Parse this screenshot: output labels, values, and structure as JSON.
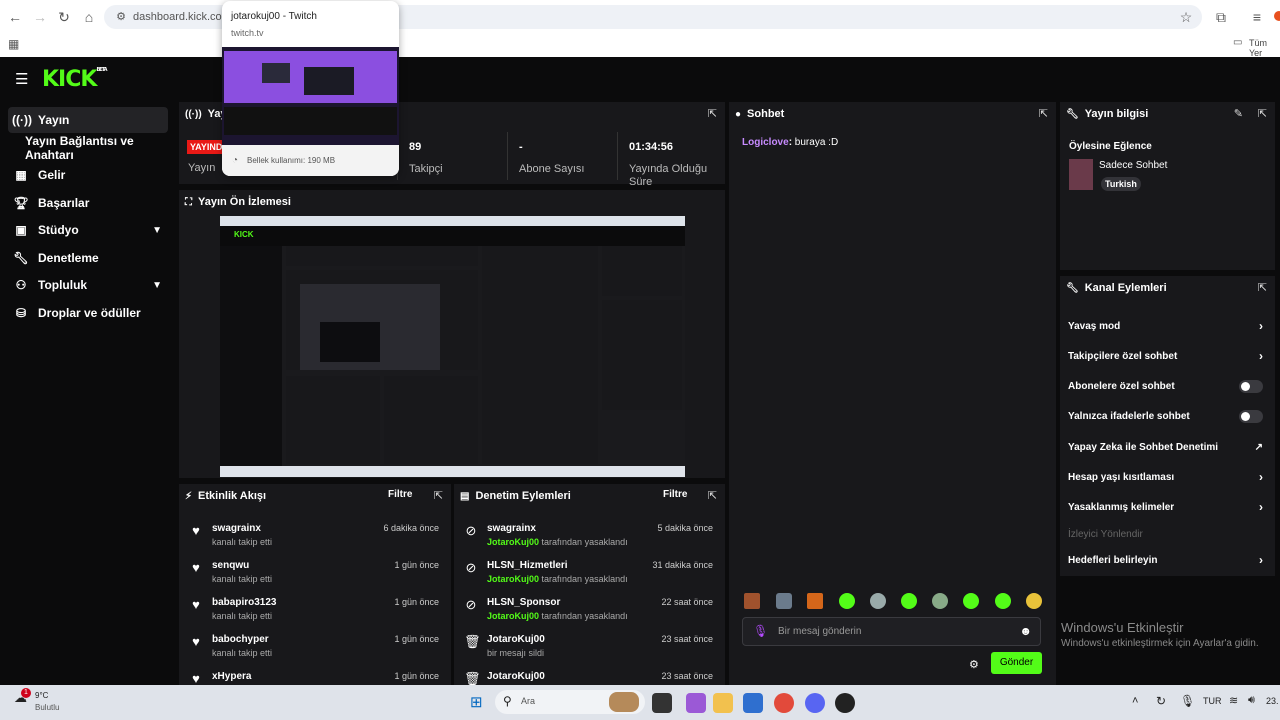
{
  "browser": {
    "url": "dashboard.kick.com/",
    "right_bookmark": "Tüm Yer",
    "tab_preview": {
      "title": "jotarokuj00 - Twitch",
      "domain": "twitch.tv",
      "memory": "Bellek kullanımı: 190 MB"
    }
  },
  "app": {
    "logo": "KICK",
    "logo_badge": "BETA"
  },
  "sidebar": {
    "items": [
      {
        "label": "Yayın",
        "icon": "broadcast-icon",
        "active": true
      },
      {
        "label": "Yayın Bağlantısı ve Anahtarı",
        "icon": "",
        "sub": true
      },
      {
        "label": "Gelir",
        "icon": "chart-icon"
      },
      {
        "label": "Başarılar",
        "icon": "trophy-icon"
      },
      {
        "label": "Stüdyo",
        "icon": "studio-icon",
        "chevron": true
      },
      {
        "label": "Denetleme",
        "icon": "wrench-icon"
      },
      {
        "label": "Topluluk",
        "icon": "community-icon",
        "chevron": true
      },
      {
        "label": "Droplar ve ödüller",
        "icon": "drops-icon"
      }
    ]
  },
  "stats": {
    "title": "Yayı",
    "live_badge": "YAYINDA",
    "items": [
      {
        "value": "89",
        "label": "Takipçi"
      },
      {
        "value": "-",
        "label": "Abone Sayısı"
      },
      {
        "value": "01:34:56",
        "label": "Yayında Olduğu Süre"
      }
    ],
    "first_label": "Yayın"
  },
  "preview": {
    "title": "Yayın Ön İzlemesi"
  },
  "activity": {
    "title": "Etkinlik Akışı",
    "filter": "Filtre",
    "rows": [
      {
        "name": "swagrainx",
        "sub": "kanalı takip etti",
        "time": "6 dakika önce"
      },
      {
        "name": "senqwu",
        "sub": "kanalı takip etti",
        "time": "1 gün önce"
      },
      {
        "name": "babapiro3123",
        "sub": "kanalı takip etti",
        "time": "1 gün önce"
      },
      {
        "name": "babochyper",
        "sub": "kanalı takip etti",
        "time": "1 gün önce"
      },
      {
        "name": "xHypera",
        "sub": "",
        "time": "1 gün önce"
      }
    ]
  },
  "moderation": {
    "title": "Denetim Eylemleri",
    "filter": "Filtre",
    "rows": [
      {
        "name": "swagrainx",
        "by": "JotaroKuj00",
        "sub": "tarafından yasaklandı",
        "time": "5 dakika önce",
        "icon": "ban-icon"
      },
      {
        "name": "HLSN_Hizmetleri",
        "by": "JotaroKuj00",
        "sub": "tarafından yasaklandı",
        "time": "31 dakika önce",
        "icon": "ban-icon"
      },
      {
        "name": "HLSN_Sponsor",
        "by": "JotaroKuj00",
        "sub": "tarafından yasaklandı",
        "time": "22 saat önce",
        "icon": "ban-icon"
      },
      {
        "name": "JotaroKuj00",
        "by": "",
        "sub": "bir mesajı sildi",
        "time": "23 saat önce",
        "icon": "trash-icon"
      },
      {
        "name": "JotaroKuj00",
        "by": "",
        "sub": "",
        "time": "23 saat önce",
        "icon": "trash-icon"
      }
    ]
  },
  "chat": {
    "title": "Sohbet",
    "messages": [
      {
        "user": "Logiclove",
        "text": " buraya :D"
      }
    ],
    "placeholder": "Bir mesaj gönderin",
    "send": "Gönder"
  },
  "stream_info": {
    "title": "Yayın bilgisi",
    "stream_title": "Öylesine Eğlence",
    "category": "Sadece Sohbet",
    "language": "Turkish"
  },
  "channel_actions": {
    "title": "Kanal Eylemleri",
    "items": [
      {
        "label": "Yavaş mod",
        "kind": "chevron"
      },
      {
        "label": "Takipçilere özel sohbet",
        "kind": "chevron"
      },
      {
        "label": "Abonelere özel sohbet",
        "kind": "toggle"
      },
      {
        "label": "Yalnızca ifadelerle sohbet",
        "kind": "toggle"
      },
      {
        "label": "Yapay Zeka ile Sohbet Denetimi",
        "kind": "external"
      },
      {
        "label": "Hesap yaşı kısıtlaması",
        "kind": "chevron"
      },
      {
        "label": "Yasaklanmış kelimeler",
        "kind": "chevron"
      },
      {
        "label": "İzleyici Yönlendir",
        "kind": "disabled"
      },
      {
        "label": "Hedefleri belirleyin",
        "kind": "chevron"
      }
    ]
  },
  "watermark": {
    "title": "Windows'u Etkinleştir",
    "sub": "Windows'u etkinleştirmek için Ayarlar'a gidin."
  },
  "taskbar": {
    "weather_temp": "9°C",
    "weather_desc": "Bulutlu",
    "weather_badge": "1",
    "search": "Ara",
    "lang": "TUR",
    "clock": "23."
  }
}
